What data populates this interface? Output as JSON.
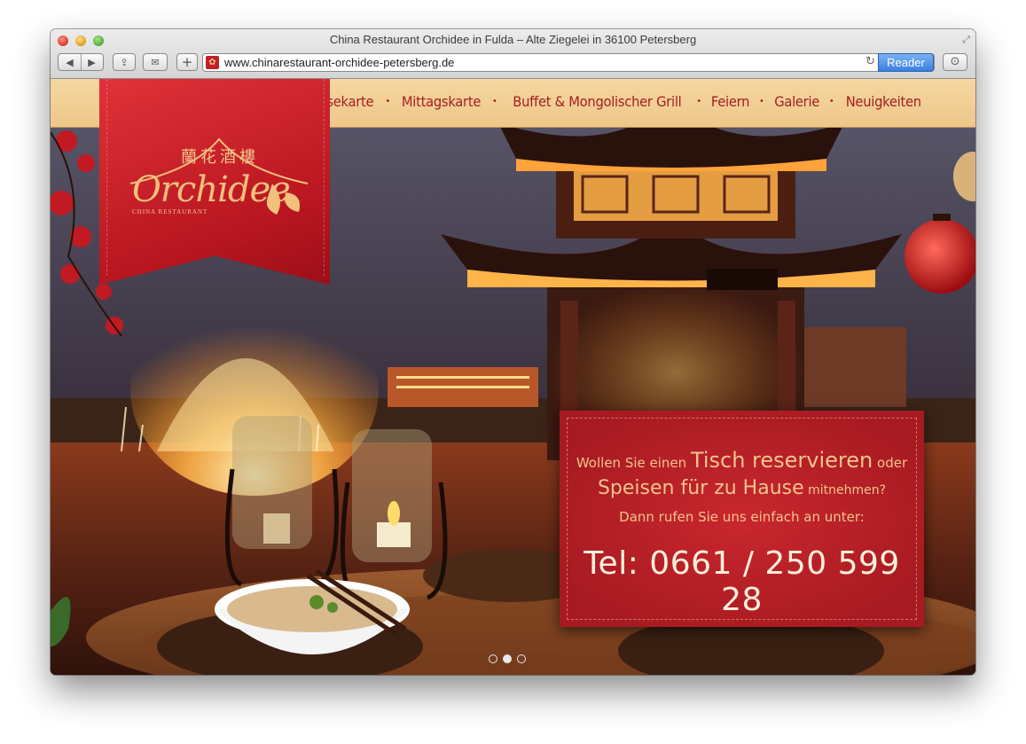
{
  "window": {
    "title": "China Restaurant Orchidee in Fulda – Alte Ziegelei in 36100 Petersberg"
  },
  "toolbar": {
    "back_icon": "◀",
    "forward_icon": "▶",
    "share_icon": "⇪",
    "mail_icon": "✉",
    "add_icon": "+",
    "url": "www.chinarestaurant-orchidee-petersberg.de",
    "reload_icon": "↻",
    "reader_label": "Reader",
    "download_icon": "⊙"
  },
  "site": {
    "nav": [
      "Speisekarte",
      "Mittagskarte",
      "Buffet & Mongolischer Grill",
      "Feiern",
      "Galerie",
      "Neuigkeiten"
    ],
    "logo": {
      "chinese": "蘭花酒樓",
      "name": "Orchidee",
      "sub": "CHINA RESTAURANT"
    },
    "promo": {
      "line1_a": "Wollen Sie einen ",
      "line1_b": "Tisch reservieren",
      "line1_c": " oder",
      "line2_a": "Speisen für zu Hause",
      "line2_b": " mitnehmen?",
      "line3": "Dann rufen Sie uns einfach an unter:",
      "tel": "Tel: 0661 / 250 599 28"
    },
    "slider": {
      "count": 3,
      "active": 2
    }
  },
  "colors": {
    "accent_red": "#b81620",
    "gold": "#f0c07c",
    "nav_bar": "#f5d7a0"
  }
}
